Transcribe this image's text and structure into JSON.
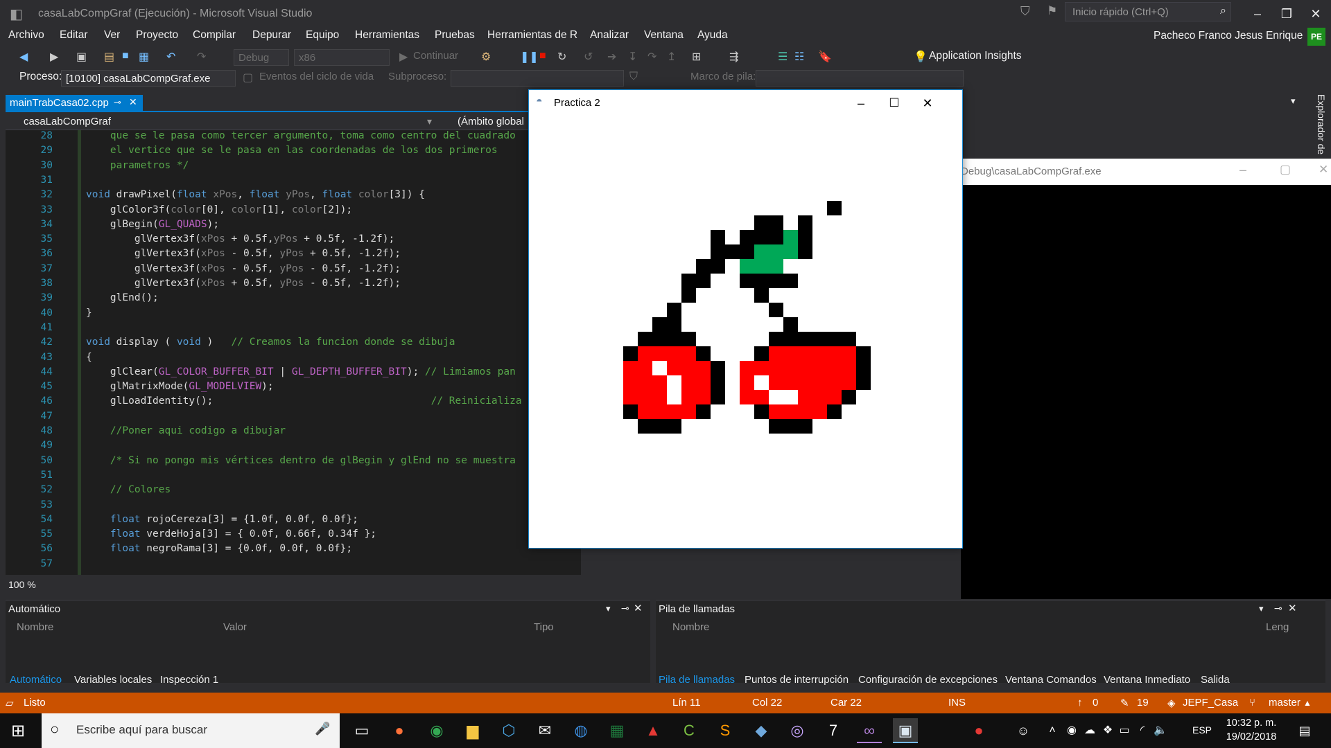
{
  "window": {
    "title": "casaLabCompGraf (Ejecución) - Microsoft Visual Studio",
    "quick_launch_placeholder": "Inicio rápido (Ctrl+Q)",
    "user": "Pacheco Franco Jesus Enrique",
    "user_initials": "PE"
  },
  "menu": [
    "Archivo",
    "Editar",
    "Ver",
    "Proyecto",
    "Compilar",
    "Depurar",
    "Equipo",
    "Herramientas",
    "Pruebas",
    "Herramientas de R",
    "Analizar",
    "Ventana",
    "Ayuda"
  ],
  "toolbar": {
    "config": "Debug",
    "platform": "x86",
    "continue_label": "Continuar",
    "app_insights": "Application Insights"
  },
  "toolbar2": {
    "process_label": "Proceso:",
    "process_value": "[10100] casaLabCompGraf.exe",
    "lifecycle_label": "Eventos del ciclo de vida",
    "subprocess_label": "Subproceso:",
    "stack_label": "Marco de pila:"
  },
  "editor": {
    "tab_name": "mainTrabCasa02.cpp",
    "project": "casaLabCompGraf",
    "scope": "(Ámbito global",
    "zoom": "100 %",
    "lines": [
      {
        "n": "28",
        "html": "<span class=\"cm\">    que se le pasa como tercer argumento, toma como centro del cuadrado</span>"
      },
      {
        "n": "29",
        "html": "<span class=\"cm\">    el vertice que se le pasa en las coordenadas de los dos primeros</span>"
      },
      {
        "n": "30",
        "html": "<span class=\"cm\">    parametros */</span>"
      },
      {
        "n": "31",
        "html": ""
      },
      {
        "n": "32",
        "html": "<span class=\"kw\">void</span> drawPixel(<span class=\"kw\">float</span> <span class=\"pm\">xPos</span>, <span class=\"kw\">float</span> <span class=\"pm\">yPos</span>, <span class=\"kw\">float</span> <span class=\"pm\">color</span>[3]) {"
      },
      {
        "n": "33",
        "html": "    glColor3f(<span class=\"pm\">color</span>[0], <span class=\"pm\">color</span>[1], <span class=\"pm\">color</span>[2]);"
      },
      {
        "n": "34",
        "html": "    glBegin(<span class=\"mc\">GL_QUADS</span>);"
      },
      {
        "n": "35",
        "html": "        glVertex3f(<span class=\"pm\">xPos</span> + 0.5f,<span class=\"pm\">yPos</span> + 0.5f, -1.2f);"
      },
      {
        "n": "36",
        "html": "        glVertex3f(<span class=\"pm\">xPos</span> - 0.5f, <span class=\"pm\">yPos</span> + 0.5f, -1.2f);"
      },
      {
        "n": "37",
        "html": "        glVertex3f(<span class=\"pm\">xPos</span> - 0.5f, <span class=\"pm\">yPos</span> - 0.5f, -1.2f);"
      },
      {
        "n": "38",
        "html": "        glVertex3f(<span class=\"pm\">xPos</span> + 0.5f, <span class=\"pm\">yPos</span> - 0.5f, -1.2f);"
      },
      {
        "n": "39",
        "html": "    glEnd();"
      },
      {
        "n": "40",
        "html": "}"
      },
      {
        "n": "41",
        "html": ""
      },
      {
        "n": "42",
        "html": "<span class=\"kw\">void</span> display ( <span class=\"kw\">void</span> )   <span class=\"cm\">// Creamos la funcion donde se dibuja</span>"
      },
      {
        "n": "43",
        "html": "{"
      },
      {
        "n": "44",
        "html": "    glClear(<span class=\"mc\">GL_COLOR_BUFFER_BIT</span> | <span class=\"mc\">GL_DEPTH_BUFFER_BIT</span>); <span class=\"cm\">// Limiamos pan</span>"
      },
      {
        "n": "45",
        "html": "    glMatrixMode(<span class=\"mc\">GL_MODELVIEW</span>);"
      },
      {
        "n": "46",
        "html": "    glLoadIdentity();                                    <span class=\"cm\">// Reinicializa</span>"
      },
      {
        "n": "47",
        "html": ""
      },
      {
        "n": "48",
        "html": "    <span class=\"cm\">//Poner aqui codigo a dibujar</span>"
      },
      {
        "n": "49",
        "html": ""
      },
      {
        "n": "50",
        "html": "    <span class=\"cm\">/* Si no pongo mis vértices dentro de glBegin y glEnd no se muestra</span>"
      },
      {
        "n": "51",
        "html": ""
      },
      {
        "n": "52",
        "html": "    <span class=\"cm\">// Colores</span>"
      },
      {
        "n": "53",
        "html": ""
      },
      {
        "n": "54",
        "html": "    <span class=\"kw\">float</span> rojoCereza[3] = {1.0f, 0.0f, 0.0f};"
      },
      {
        "n": "55",
        "html": "    <span class=\"kw\">float</span> verdeHoja[3] = { 0.0f, 0.66f, 0.34f };"
      },
      {
        "n": "56",
        "html": "    <span class=\"kw\">float</span> negroRama[3] = {0.0f, 0.0f, 0.0f};"
      },
      {
        "n": "57",
        "html": ""
      }
    ]
  },
  "gl_window": {
    "title": "Practica 2",
    "colors": {
      "red": "#ff0000",
      "green": "#00a857",
      "black": "#000000",
      "white": "#ffffff"
    }
  },
  "console": {
    "title": "Debug\\casaLabCompGraf.exe"
  },
  "panels": {
    "left": {
      "title": "Automático",
      "headers": [
        "Nombre",
        "Valor",
        "Tipo"
      ],
      "tabs": [
        "Automático",
        "Variables locales",
        "Inspección 1"
      ]
    },
    "right": {
      "title": "Pila de llamadas",
      "headers": [
        "Nombre",
        "Leng"
      ],
      "tabs": [
        "Pila de llamadas",
        "Puntos de interrupción",
        "Configuración de excepciones",
        "Ventana Comandos",
        "Ventana Inmediato",
        "Salida"
      ]
    },
    "side_tab": "Explorador de"
  },
  "status": {
    "state": "Listo",
    "line": "Lín 11",
    "col": "Col 22",
    "char": "Car 22",
    "mode": "INS",
    "up": "0",
    "edits": "19",
    "repo": "JEPF_Casa",
    "branch": "master"
  },
  "taskbar": {
    "search": "Escribe aquí para buscar",
    "lang": "ESP",
    "time": "10:32 p. m.",
    "date": "19/02/2018"
  }
}
